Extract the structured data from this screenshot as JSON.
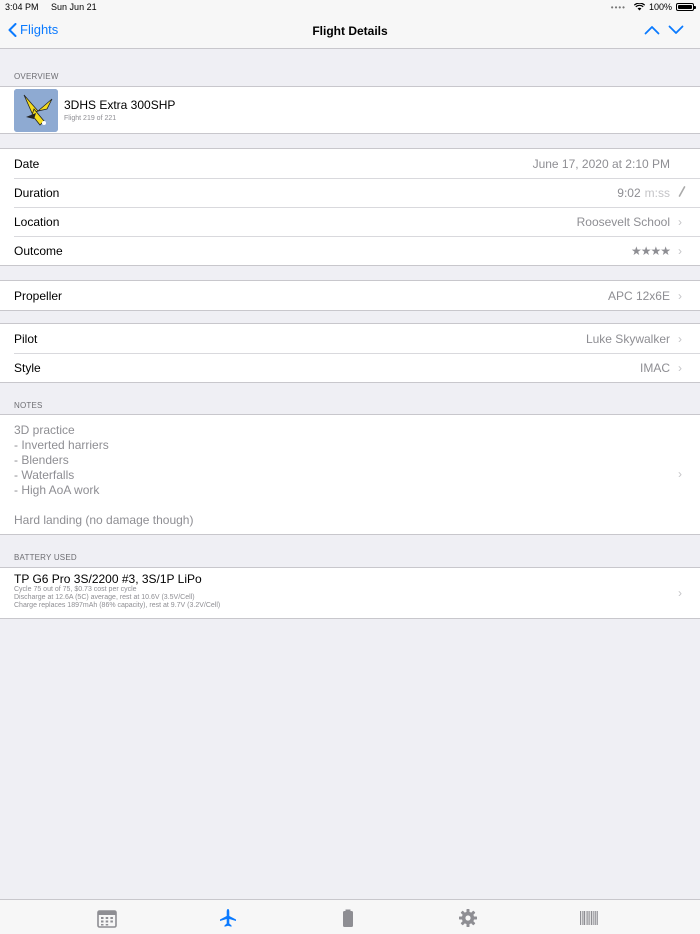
{
  "status_bar": {
    "time": "3:04 PM",
    "date": "Sun Jun 21",
    "battery_pct": "100%"
  },
  "nav": {
    "back_label": "Flights",
    "title": "Flight Details"
  },
  "overview": {
    "header": "OVERVIEW",
    "title": "3DHS Extra 300SHP",
    "subtitle": "Flight 219 of 221"
  },
  "details": {
    "date_label": "Date",
    "date_value": "June 17, 2020 at 2:10 PM",
    "duration_label": "Duration",
    "duration_value": "9:02",
    "duration_unit": "m:ss",
    "location_label": "Location",
    "location_value": "Roosevelt School",
    "outcome_label": "Outcome",
    "outcome_stars": "★★★★",
    "outcome_rating": 4
  },
  "propeller": {
    "label": "Propeller",
    "value": "APC 12x6E"
  },
  "pilot": {
    "pilot_label": "Pilot",
    "pilot_value": "Luke Skywalker",
    "style_label": "Style",
    "style_value": "IMAC"
  },
  "notes": {
    "header": "NOTES",
    "lines": [
      "3D practice",
      "- Inverted harriers",
      "- Blenders",
      "- Waterfalls",
      "- High AoA work",
      "",
      "Hard landing (no damage though)"
    ]
  },
  "battery": {
    "header": "BATTERY USED",
    "title": "TP G6 Pro 3S/2200 #3, 3S/1P LiPo",
    "line1": "Cycle 75 out of 75, $0.73 cost per cycle",
    "line2": "Discharge at 12.6A (5C) average, rest at 10.6V (3.5V/Cell)",
    "line3": "Charge replaces 1897mAh (86% capacity), rest at 9.7V (3.2V/Cell)"
  },
  "tabs": [
    {
      "name": "calendar-icon"
    },
    {
      "name": "airplane-icon",
      "active": true
    },
    {
      "name": "battery-icon"
    },
    {
      "name": "gear-icon"
    },
    {
      "name": "barcode-icon"
    }
  ],
  "colors": {
    "accent": "#0a7aff",
    "inactive_tab": "#8e8e93"
  }
}
